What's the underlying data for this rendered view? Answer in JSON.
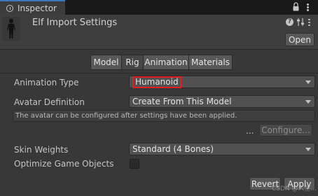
{
  "window": {
    "tab_label": "Inspector"
  },
  "header": {
    "title": "Elf Import Settings",
    "help_glyph": "?",
    "open_label": "Open"
  },
  "toolbar": {
    "tabs": [
      {
        "label": "Model",
        "active": false
      },
      {
        "label": "Rig",
        "active": true
      },
      {
        "label": "Animation",
        "active": false
      },
      {
        "label": "Materials",
        "active": false
      }
    ]
  },
  "rig": {
    "animation_type_label": "Animation Type",
    "animation_type_value": "Humanoid",
    "avatar_definition_label": "Avatar Definition",
    "avatar_definition_value": "Create From This Model",
    "info_text": "The avatar can be configured after settings have been applied.",
    "ellipsis": "...",
    "configure_label": "Configure...",
    "skin_weights_label": "Skin Weights",
    "skin_weights_value": "Standard (4 Bones)",
    "optimize_label": "Optimize Game Objects",
    "optimize_checked": false
  },
  "footer": {
    "revert_label": "Revert",
    "apply_label": "Apply",
    "watermark": "CSDN @人生..."
  },
  "colors": {
    "highlight": "#e11d1d",
    "tab_accent": "#3a79bb"
  }
}
